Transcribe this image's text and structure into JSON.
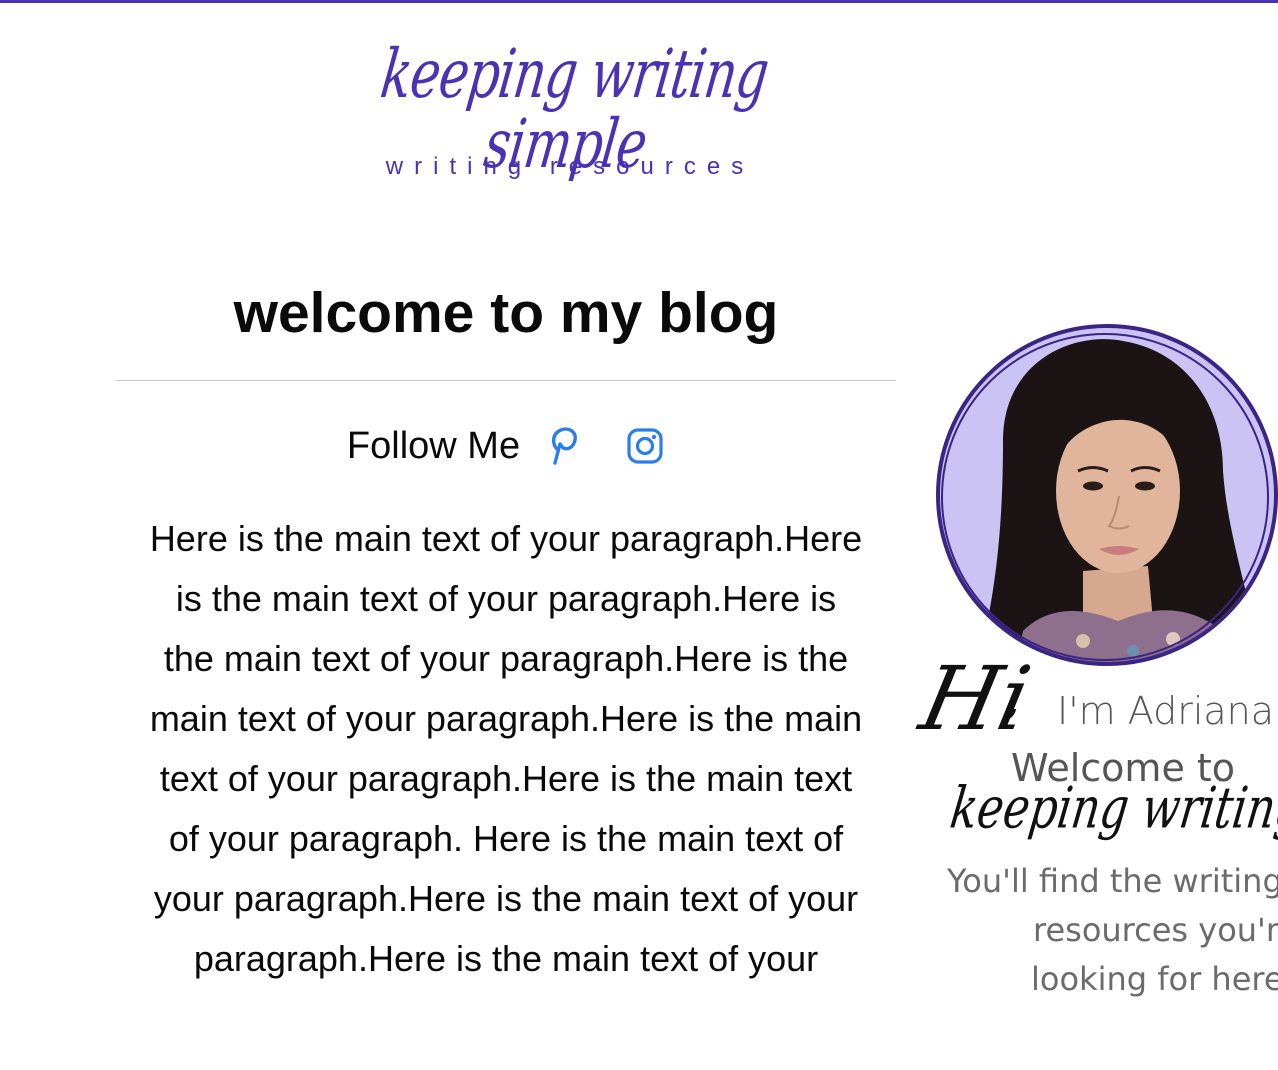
{
  "brand": {
    "logo_script": "keeping writing simple",
    "logo_subtitle": "writing resources",
    "accent_color": "#4b32b5"
  },
  "main": {
    "title": "welcome to my blog",
    "follow_label": "Follow Me",
    "social": [
      {
        "icon": "pinterest-icon",
        "color": "#2b7de9"
      },
      {
        "icon": "instagram-icon",
        "color": "#2b7de9"
      }
    ],
    "paragraph": "Here is the main text of your paragraph.Here is the main text of your paragraph.Here is the main text of your paragraph.Here is the main text of your paragraph.Here is the main text of your paragraph.Here is the main text of your paragraph. Here is the main text of your paragraph.Here is the main text of your paragraph.Here is the main text of your"
  },
  "sidebar": {
    "hi": "Hi",
    "comma": ",",
    "intro": "I'm Adriana",
    "welcome": "Welcome to",
    "brand_script": "keeping writing simple",
    "line1": "You'll find the writing",
    "line2": "resources you're",
    "line3": "looking for here",
    "portrait_bg": "#cbc3f3"
  }
}
